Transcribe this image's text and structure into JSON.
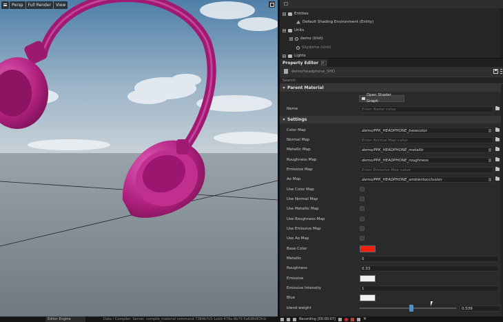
{
  "viewport": {
    "toolbar": {
      "camera_label": "Persp",
      "render_mode_label": "Full Render",
      "view_label": "View"
    }
  },
  "scene_tree": {
    "items": [
      {
        "label": "Entities",
        "icon": "folder-icon"
      },
      {
        "label": "Default Shading Environment (Entity)",
        "icon": "entity-icon"
      },
      {
        "label": "Units",
        "icon": "folder-icon"
      },
      {
        "label": "demo (Unit)",
        "icon": "unit-icon"
      },
      {
        "label": "Skydome (Unit)",
        "icon": "unit-icon"
      },
      {
        "label": "Lights",
        "icon": "folder-icon"
      }
    ]
  },
  "property_editor": {
    "tab_label": "Property Editor",
    "tab_close": "×",
    "asset_path": "demo/headphone_SHD",
    "search_placeholder": "Search",
    "parent_material": {
      "header": "Parent Material",
      "open_button_label": "Open Shader Graph",
      "name_label": "Name",
      "name_placeholder": "Enter Name value"
    },
    "settings": {
      "header": "Settings",
      "maps": [
        {
          "label": "Color Map",
          "value": "demo/PPK_HEADPHONE_basecolor",
          "empty": false
        },
        {
          "label": "Normal Map",
          "value": "Enter Normal Map value",
          "empty": true
        },
        {
          "label": "Metallic Map",
          "value": "demo/PPK_HEADPHONE_metallic",
          "empty": false
        },
        {
          "label": "Roughness Map",
          "value": "demo/PPK_HEADPHONE_roughness",
          "empty": false
        },
        {
          "label": "Emissive Map",
          "value": "Enter Emissive Map value",
          "empty": true
        },
        {
          "label": "Ao Map",
          "value": "demo/PPK_HEADPHONE_ambientocclusion",
          "empty": false
        }
      ],
      "toggles": [
        {
          "label": "Use Color Map",
          "checked": false
        },
        {
          "label": "Use Normal Map",
          "checked": false
        },
        {
          "label": "Use Metallic Map",
          "checked": false
        },
        {
          "label": "Use Roughness Map",
          "checked": false
        },
        {
          "label": "Use Emissive Map",
          "checked": false
        },
        {
          "label": "Use Ao Map",
          "checked": false
        }
      ],
      "base_color": {
        "label": "Base Color",
        "color": "#f02010"
      },
      "metallic": {
        "label": "Metallic",
        "value": "0"
      },
      "roughness": {
        "label": "Roughness",
        "value": "0.33"
      },
      "emissive": {
        "label": "Emissive",
        "color": "#f0f0f0"
      },
      "emissive_intensity": {
        "label": "Emissive Intensity",
        "value": "1"
      },
      "blue": {
        "label": "Blue",
        "color": "#f0f0f0"
      },
      "blend_weight": {
        "label": "blend weight",
        "value": "0.539",
        "fraction": 0.539
      }
    }
  },
  "status_bar": {
    "engine_label": "Editor Engine",
    "message": "Data / Compiler: Server, compile_material command 7384b7c5-1ebd-478a-9b70-5a698d83fcb",
    "recording_label": "Recording [00:00:07]",
    "close_glyph": "✕"
  },
  "colors": {
    "headphone": "#b0207e",
    "accent_blue": "#4e8fc7"
  }
}
